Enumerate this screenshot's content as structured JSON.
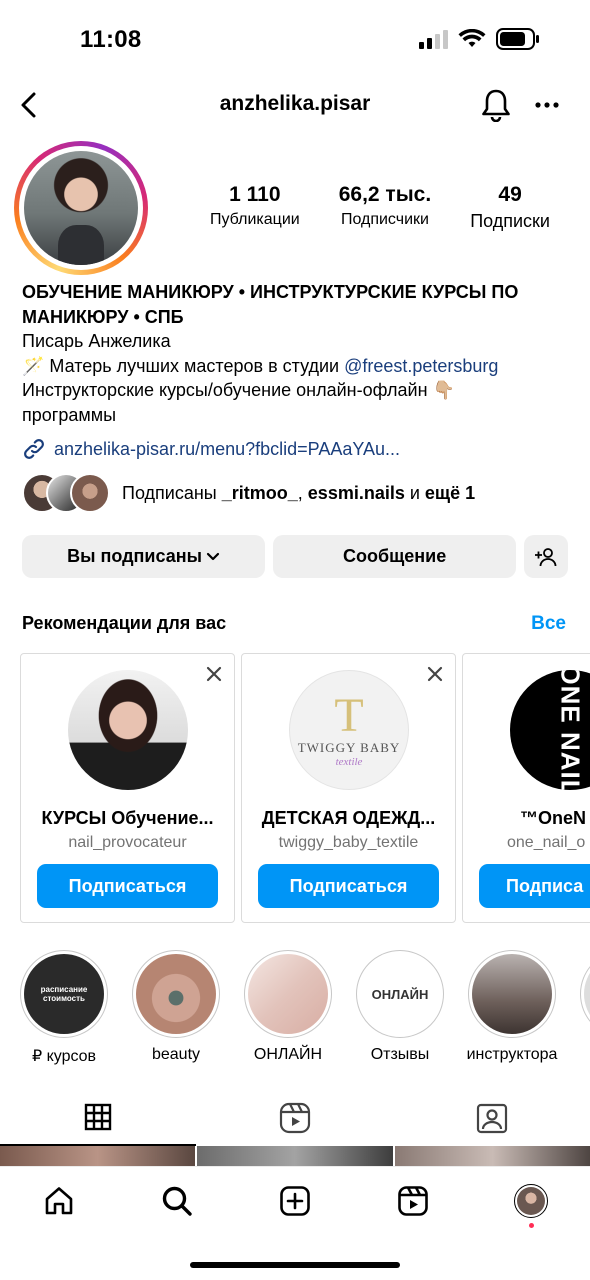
{
  "status": {
    "time": "11:08"
  },
  "nav": {
    "username": "anzhelika.pisar"
  },
  "stats": [
    {
      "num": "1 110",
      "label": "Публикации"
    },
    {
      "num": "66,2 тыс.",
      "label": "Подписчики"
    },
    {
      "num": "49",
      "label": "Подписки"
    }
  ],
  "bio": {
    "headline": "ОБУЧЕНИЕ МАНИКЮРУ • ИНСТРУКТУРСКИЕ КУРСЫ ПО МАНИКЮРУ • СПБ",
    "name": "Писарь Анжелика",
    "line1_prefix": "🪄 Матерь лучших мастеров в студии ",
    "line1_mention": "@freest.petersburg",
    "line2": "Инструкторские курсы/обучение онлайн-офлайн 👇🏼",
    "line3": "программы"
  },
  "link": {
    "text": "anzhelika-pisar.ru/menu?fbclid=PAAaYAu..."
  },
  "followed_by": {
    "prefix": "Подписаны ",
    "user1": "_ritmoo_",
    "sep": ", ",
    "user2": "essmi.nails",
    "suffix_and": " и ",
    "suffix_more": "ещё 1"
  },
  "actions": {
    "following": "Вы подписаны",
    "message": "Сообщение"
  },
  "recommendations": {
    "title": "Рекомендации для вас",
    "see_all": "Все",
    "cards": [
      {
        "title": "КУРСЫ Обучение...",
        "handle": "nail_provocateur",
        "follow": "Подписаться"
      },
      {
        "title": "ДЕТСКАЯ ОДЕЖД...",
        "handle": "twiggy_baby_textile",
        "follow": "Подписаться",
        "logo_line1": "TWIGGY BABY",
        "logo_line2": "textile"
      },
      {
        "title": "™OneN",
        "handle": "one_nail_o",
        "follow": "Подписа",
        "logo": "ONE NAIL"
      }
    ]
  },
  "highlights": [
    {
      "caption": "₽ курсов",
      "cover_text_1": "расписание",
      "cover_text_2": "стоимость"
    },
    {
      "caption": "beauty"
    },
    {
      "caption": "ОНЛАЙН"
    },
    {
      "caption": "Отзывы",
      "cover_text_1": "ОНЛАЙН"
    },
    {
      "caption": "инструктора"
    }
  ],
  "colors": {
    "accent": "#0095f6",
    "link": "#1a3e7c",
    "button_bg": "#efefef",
    "muted": "#737373"
  }
}
